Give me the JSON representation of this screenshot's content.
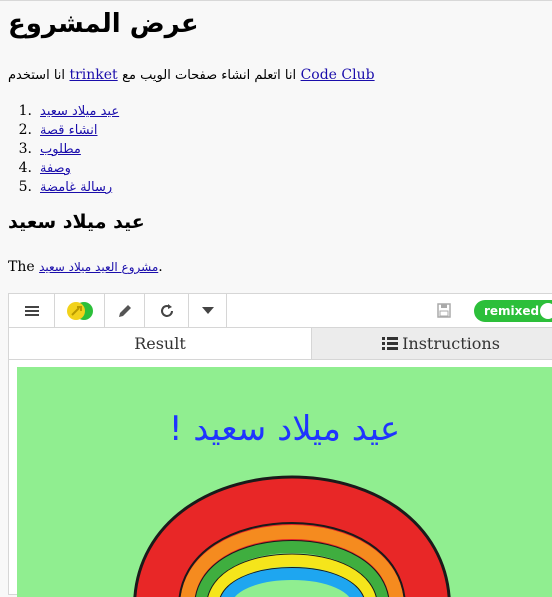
{
  "page": {
    "title": "عرض المشروع",
    "intro": {
      "arabic_prefix": "انا استخدم",
      "trinket_link": "trinket",
      "arabic_middle": "انا اتعلم انشاء صفحات الويب مع",
      "codeclub_link": "Code Club"
    },
    "projects": [
      {
        "num": "1.",
        "label": "عيد ميلاد سعيد"
      },
      {
        "num": "2.",
        "label": "انشاء قصة"
      },
      {
        "num": "3.",
        "label": "مطلوب"
      },
      {
        "num": "4.",
        "label": "وصفة"
      },
      {
        "num": "5.",
        "label": "رسالة غامضة"
      }
    ],
    "section_title": "عيد ميلاد سعيد",
    "section_line": {
      "prefix": "The",
      "link": "مشروع العيد ميلاد سعيد",
      "suffix": "."
    }
  },
  "embed": {
    "toolbar": {
      "menu_icon": "hamburger-icon",
      "avatar_icon": "avatar-icon",
      "edit_icon": "pencil-icon",
      "refresh_icon": "refresh-icon",
      "dropdown_icon": "caret-down-icon",
      "save_icon": "save-icon",
      "remixed_label": "remixed"
    },
    "tabs": {
      "result": "Result",
      "instructions": "Instructions"
    },
    "result": {
      "card_text": "عيد ميلاد سعيد !",
      "background": "#90ee90",
      "text_color": "#1f34ff"
    }
  }
}
